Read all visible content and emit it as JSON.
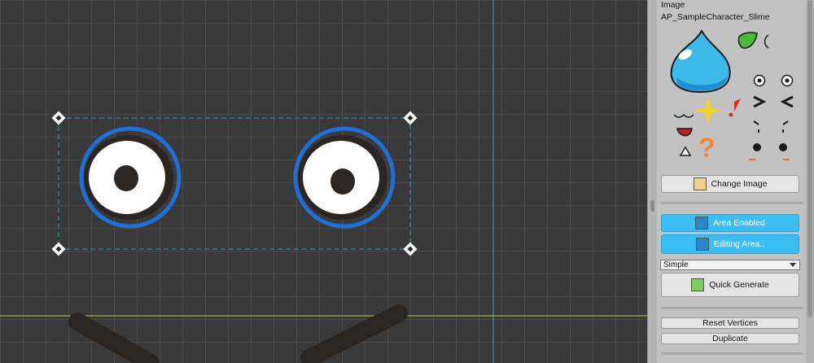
{
  "inspector": {
    "section_label": "Image",
    "image_name": "AP_SampleCharacter_Slime",
    "change_image_label": "Change Image",
    "area_enabled_label": "Area Enabled",
    "editing_area_label": "Editing Area..",
    "mode_select_value": "Simple",
    "quick_generate_label": "Quick Generate",
    "reset_vertices_label": "Reset Vertices",
    "duplicate_label": "Duplicate"
  },
  "icons": {
    "change_image": "image-swap-icon",
    "area_enabled": "star-icon",
    "editing_area": "wand-icon",
    "quick_generate": "generate-icon"
  },
  "colors": {
    "viewport_bg": "#393939",
    "grid": "#4b4b4b",
    "eye_outline": "#1e6fd6",
    "area_box": "#1aa3b8",
    "accent_button": "#3bbdf6",
    "panel_bg": "#c2c2c2"
  }
}
